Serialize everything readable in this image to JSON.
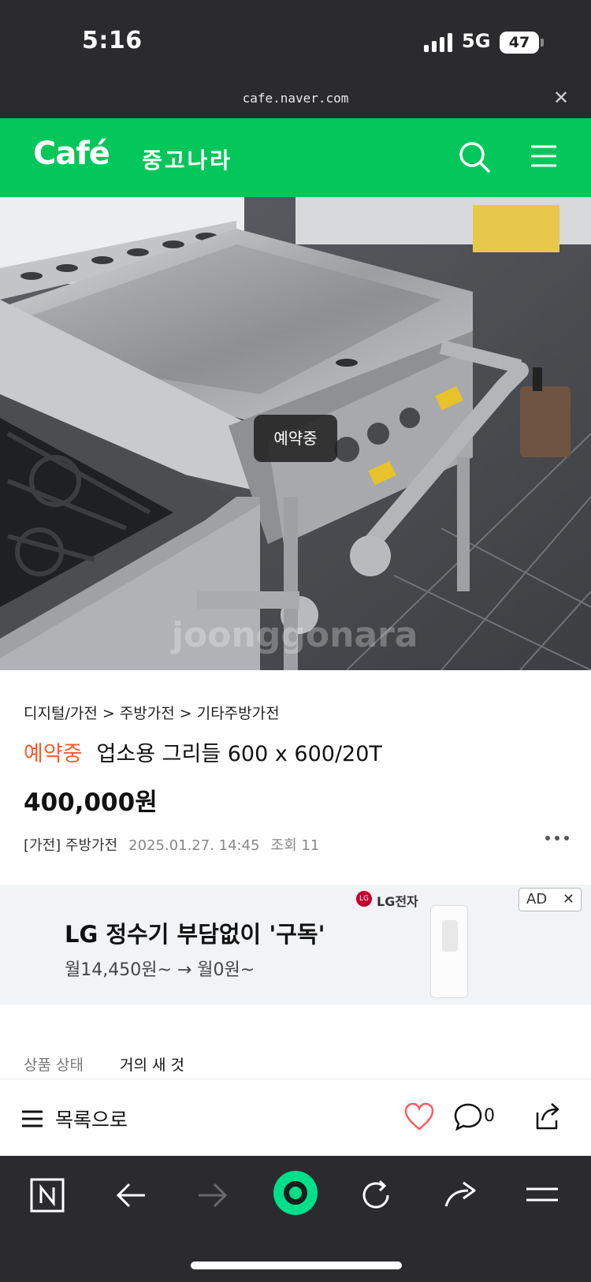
{
  "status_bar": {
    "time": "5:16",
    "network": "5G",
    "battery": "47"
  },
  "browser": {
    "url": "cafe.naver.com"
  },
  "cafe_header": {
    "logo": "Café",
    "cafe_name": "중고나라"
  },
  "photo": {
    "badge": "예약중",
    "watermark": "joonggonara"
  },
  "product": {
    "breadcrumb": "디지털/가전 > 주방가전 > 기타주방가전",
    "status": "예약중",
    "title": "업소용 그리들 600 x 600/20T",
    "price": "400,000원",
    "board": "[가전] 주방가전",
    "date": "2025.01.27. 14:45",
    "views": "조회 11"
  },
  "ad": {
    "brand": "LG전자",
    "brand_logo": "LG",
    "badge": "AD",
    "close": "✕",
    "title": "LG 정수기 부담없이 '구독'",
    "subtitle": "월14,450원~ → 월0원~"
  },
  "condition": {
    "label": "상품 상태",
    "value": "거의 새 것"
  },
  "action_bar": {
    "list_label": "목록으로",
    "comment_count": "0"
  },
  "colors": {
    "green": "#03c75a",
    "reserve_orange": "#ff5a2a",
    "dark": "#2b2b2d",
    "media_green": "#00e08a"
  }
}
